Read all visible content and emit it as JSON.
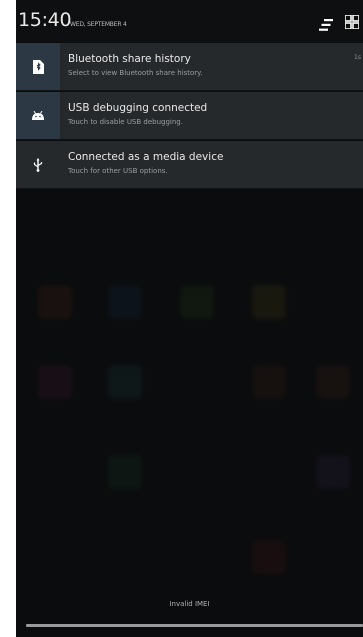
{
  "status": {
    "time": "15:40",
    "date": "WED, SEPTEMBER 4"
  },
  "notifications": [
    {
      "title": "Bluetooth share history",
      "subtitle": "Select to view Bluetooth share history.",
      "time": "1s",
      "icon": "file-icon"
    },
    {
      "title": "USB debugging connected",
      "subtitle": "Touch to disable USB debugging.",
      "icon": "android-icon"
    },
    {
      "title": "Connected as a media device",
      "subtitle": "Touch for other USB options.",
      "icon": "usb-icon"
    }
  ],
  "footer": {
    "carrier": "Invalid IMEI"
  },
  "colors": {
    "shade_bg": "#0b0c0d",
    "notification_bg": "#26292c",
    "icon_column_bg": "#2c3944"
  }
}
